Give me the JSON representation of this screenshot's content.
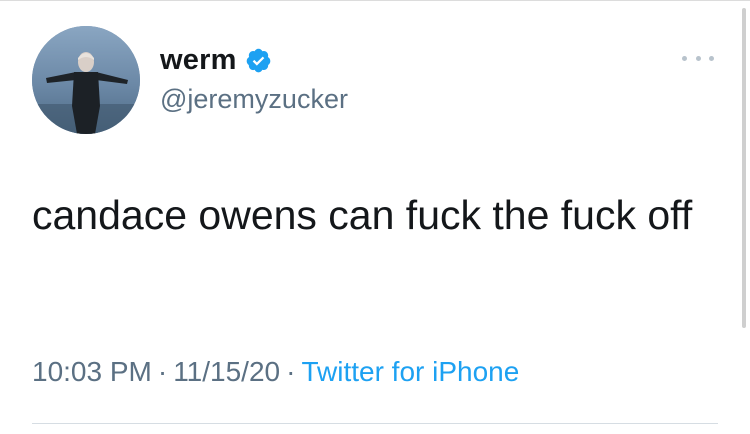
{
  "tweet": {
    "display_name": "werm",
    "handle": "@jeremyzucker",
    "verified": true,
    "text": "candace owens can fuck the fuck off",
    "time": "10:03 PM",
    "date": "11/15/20",
    "separator": "·",
    "source": "Twitter for iPhone"
  },
  "icons": {
    "verified": "verified-badge-icon",
    "more": "more-options-icon"
  },
  "colors": {
    "verified_blue": "#1da1f2",
    "link_blue": "#1da1f2",
    "secondary_text": "#5b7083",
    "primary_text": "#14171a"
  }
}
